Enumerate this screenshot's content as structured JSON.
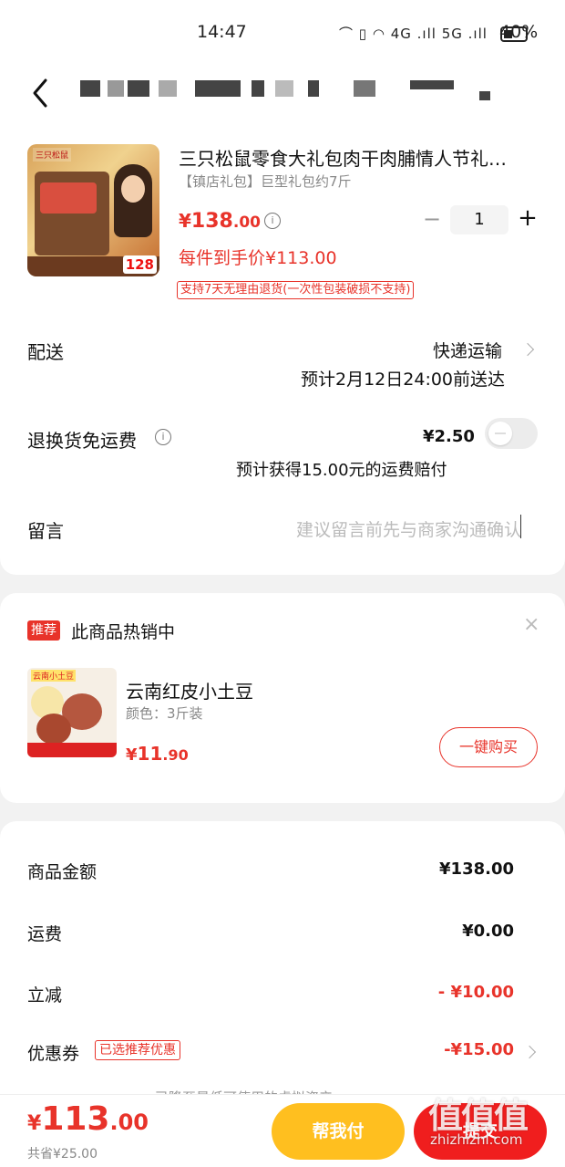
{
  "status_bar": {
    "time": "14:47",
    "signal": "4G .ıll  5G .ıll",
    "battery": "40%"
  },
  "nav": {
    "title_obscured": true
  },
  "product": {
    "image_brand": "三只松鼠",
    "image_price": "128",
    "title": "三只松鼠零食大礼包肉干肉脯情人节礼…",
    "sku": "【镇店礼包】巨型礼包约7斤",
    "price_yen": "¥",
    "price_int": "138",
    "price_dec": ".00",
    "quantity": "1",
    "minus_label": "−",
    "plus_label": "+",
    "per_item_price": "每件到手价¥113.00",
    "return_policy": "支持7天无理由退货(一次性包装破损不支持)"
  },
  "delivery": {
    "label": "配送",
    "method": "快递运输",
    "eta": "预计2月12日24:00前送达"
  },
  "return_insurance": {
    "label": "退换货免运费",
    "fee": "¥2.50",
    "compensation": "预计获得15.00元的运费赔付",
    "enabled": false
  },
  "message": {
    "label": "留言",
    "placeholder": "建议留言前先与商家沟通确认"
  },
  "recommend": {
    "badge": "推荐",
    "title": "此商品热销中",
    "close": "×",
    "image_label": "云南小土豆",
    "name": "云南红皮小土豆",
    "variant": "颜色：3斤装",
    "price_yen": "¥",
    "price_int": "11",
    "price_dec": ".90",
    "buy_label": "一键购买"
  },
  "summary": {
    "goods_label": "商品金额",
    "goods_value": "¥138.00",
    "shipping_label": "运费",
    "shipping_value": "¥0.00",
    "discount_label": "立减",
    "discount_value": "- ¥10.00",
    "coupon_label": "优惠券",
    "coupon_tag": "已选推荐优惠",
    "coupon_value": "-¥15.00",
    "cut_note": "已降至最低可使用的虚拟资产"
  },
  "bottom": {
    "total_yen": "¥",
    "total_int": "113",
    "total_dec": ".00",
    "saved": "共省¥25.00",
    "help_pay": "帮我付",
    "submit": "提交"
  },
  "watermark": {
    "logo": "值值值",
    "text": "zhizhizhi.com"
  },
  "colors": {
    "accent_red": "#e8332a",
    "help_yellow": "#ffbf1f",
    "submit_red": "#f01e1e"
  }
}
